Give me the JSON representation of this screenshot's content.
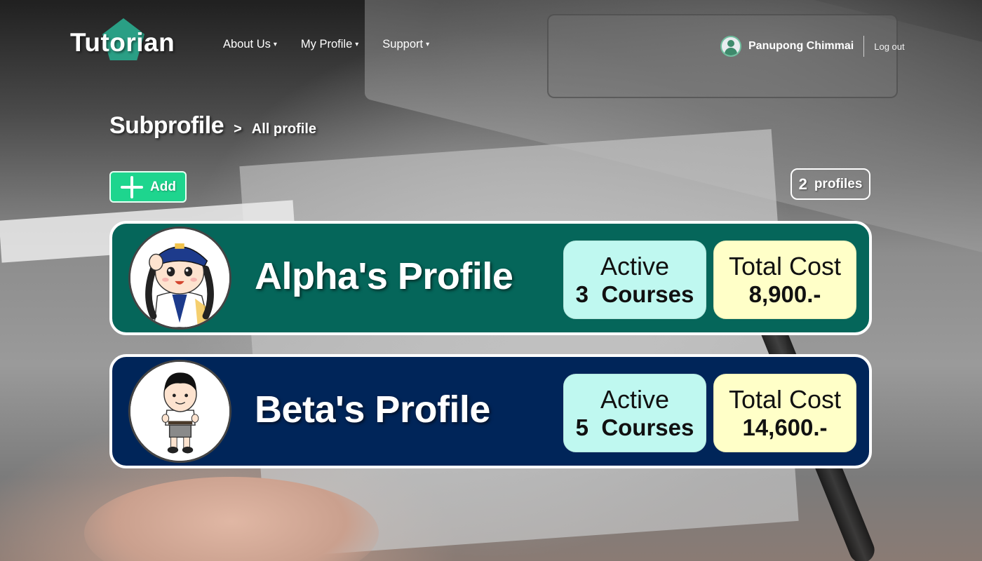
{
  "brand": {
    "name": "Tutorian",
    "accent": "#2a9f85"
  },
  "nav": {
    "items": [
      {
        "label": "About Us",
        "caret": "▾"
      },
      {
        "label": "My Profile",
        "caret": "▾"
      },
      {
        "label": "Support",
        "caret": "▾"
      }
    ]
  },
  "user": {
    "name": "Panupong Chimmai",
    "logout_label": "Log out",
    "avatar_icon": "user-avatar-icon"
  },
  "breadcrumb": {
    "main": "Subprofile",
    "separator": ">",
    "current": "All profile"
  },
  "toolbar": {
    "add_label": "Add",
    "add_color": "#1ed58e",
    "profile_count": "2",
    "profile_count_label": "profiles"
  },
  "profiles": [
    {
      "name": "Alpha's Profile",
      "card_color": "#05665a",
      "active_label": "Active",
      "active_count": "3",
      "courses_label": "Courses",
      "cost_label": "Total Cost",
      "cost_value": "8,900.-"
    },
    {
      "name": "Beta's Profile",
      "card_color": "#002559",
      "active_label": "Active",
      "active_count": "5",
      "courses_label": "Courses",
      "cost_label": "Total Cost",
      "cost_value": "14,600.-"
    }
  ]
}
